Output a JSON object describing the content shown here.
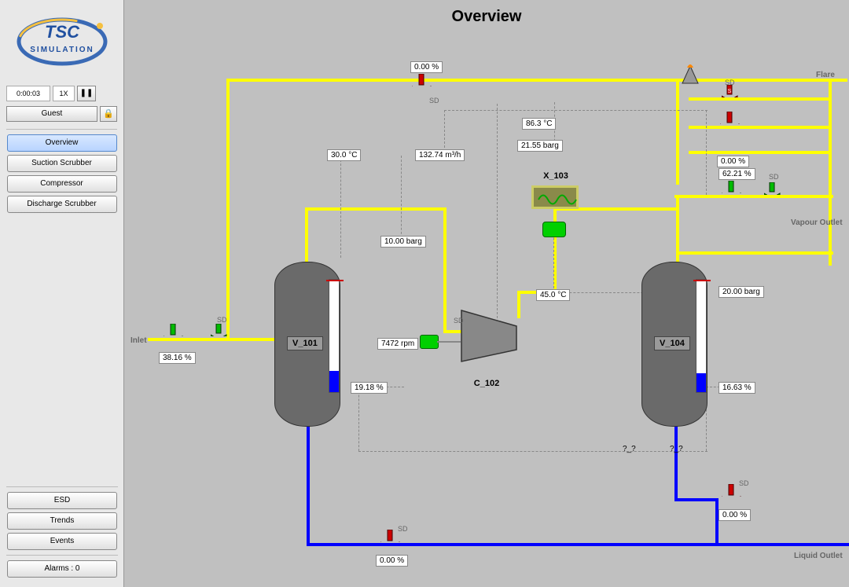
{
  "header": {
    "title": "Overview"
  },
  "sim": {
    "time": "0:00:03",
    "speed": "1X",
    "user": "Guest"
  },
  "nav": {
    "overview": "Overview",
    "suction": "Suction Scrubber",
    "compressor": "Compressor",
    "discharge": "Discharge Scrubber",
    "esd": "ESD",
    "trends": "Trends",
    "events": "Events",
    "alarms": "Alarms : 0"
  },
  "streams": {
    "inlet": "Inlet",
    "flare": "Flare",
    "vapour": "Vapour Outlet",
    "liquid": "Liquid Outlet"
  },
  "values": {
    "pcv_top": "0.00 %",
    "temp_left": "30.0 °C",
    "flow_mid": "132.74 m³/h",
    "temp_hx_in": "86.3 °C",
    "press_hx": "21.55 barg",
    "press_v101": "10.00 barg",
    "rpm": "7472 rpm",
    "temp_hx_out": "45.0 °C",
    "fcv_inlet": "38.16 %",
    "lvl_v101": "19.18 %",
    "lvl_v104": "16.63 %",
    "press_v104": "20.00 barg",
    "fcv_vapour": "62.21 %",
    "fcv_flare2": "0.00 %",
    "lcv_v101": "0.00 %",
    "lcv_v104": "0.00 %",
    "qmark1": "?_?",
    "qmark2": "?_?"
  },
  "tags": {
    "v101": "V_101",
    "c102": "C_102",
    "x103": "X_103",
    "v104": "V_104",
    "sd": "SD"
  }
}
